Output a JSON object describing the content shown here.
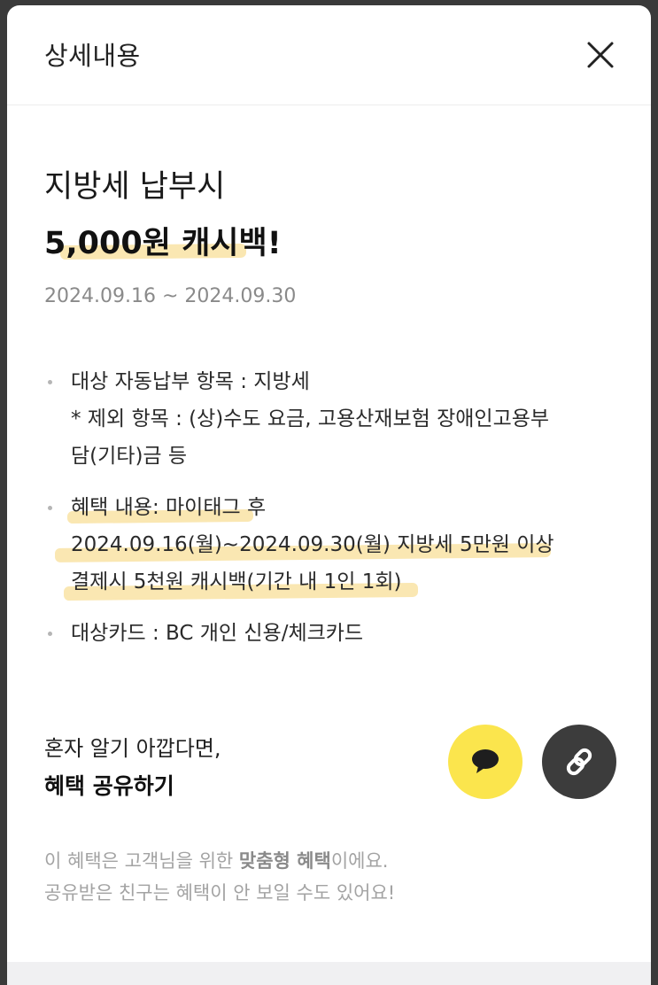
{
  "header": {
    "title": "상세내용"
  },
  "promo": {
    "headline_line1": "지방세 납부시",
    "headline_line2": "5,000원 캐시백!",
    "period": "2024.09.16 ~ 2024.09.30"
  },
  "details": {
    "item1_line1": "대상 자동납부 항목 : 지방세",
    "item1_line2": "* 제외 항목 : (상)수도 요금, 고용산재보험 장애인고용부",
    "item1_line3": "담(기타)금 등",
    "item2_line1": "혜택 내용: 마이태그 후",
    "item2_line2": "2024.09.16(월)~2024.09.30(월) 지방세 5만원 이상",
    "item2_line3": "결제시 5천원 캐시백(기간 내 1인 1회)",
    "item3_line1": "대상카드 : BC 개인 신용/체크카드"
  },
  "share": {
    "subtitle": "혼자 알기 아깝다면,",
    "title": "혜택 공유하기",
    "kakao_icon": "speech-bubble-icon",
    "link_icon": "link-icon"
  },
  "notice": {
    "line1_pre": "이 혜택은 고객님을 위한 ",
    "line1_bold": "맞춤형 혜택",
    "line1_post": "이에요.",
    "line2": "공유받은 친구는 혜택이 안 보일 수도 있어요!"
  },
  "colors": {
    "highlight": "#f9e3a4",
    "kakao_yellow": "#fbe54d",
    "link_button": "#3c3c3c"
  }
}
